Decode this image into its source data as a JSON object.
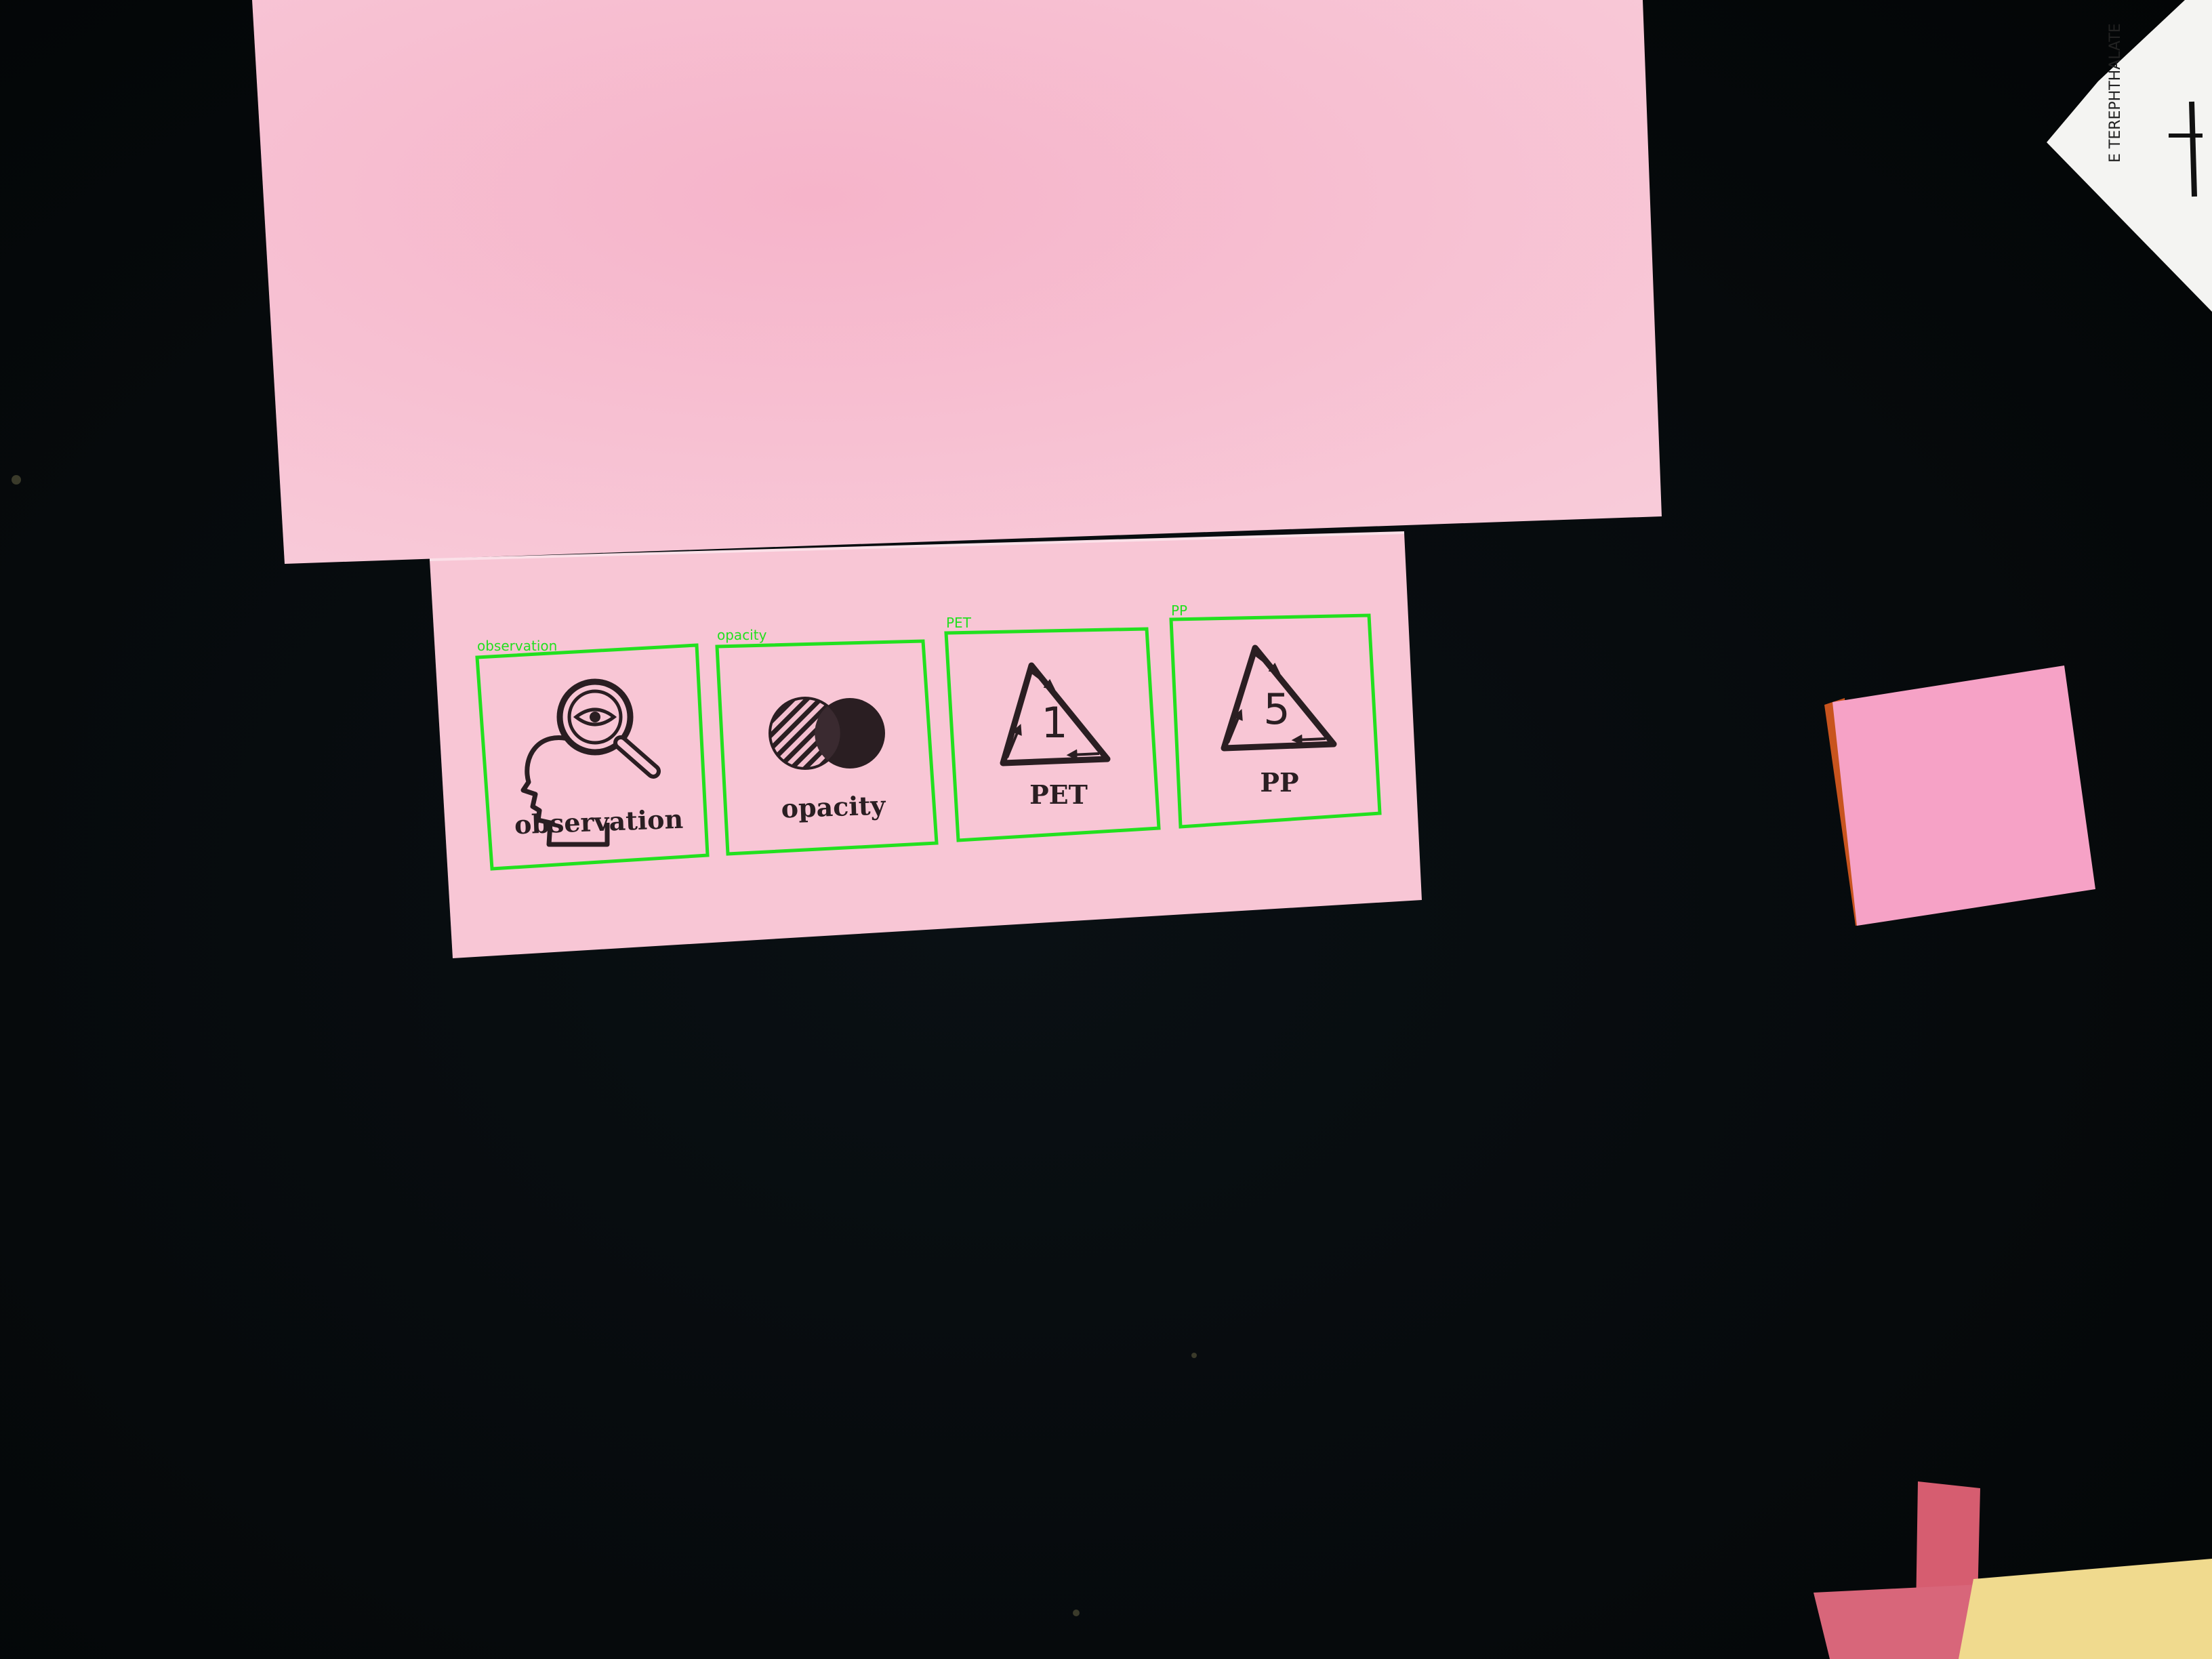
{
  "scene": {
    "background_color": "#05090b",
    "paper_color": "#f7c3d3",
    "sticky_note_color": "#f5a3c4",
    "detection_color": "#22e01f"
  },
  "icons": {
    "observation": {
      "caption": "observation",
      "detection_label": "observation",
      "icon": "head-magnifier-eye-icon"
    },
    "opacity": {
      "caption": "opacity",
      "detection_label": "opacity",
      "icon": "overlapping-circles-icon"
    },
    "pet": {
      "caption": "PET",
      "detection_label": "PET",
      "code": "1",
      "icon": "recycle-triangle-icon"
    },
    "pp": {
      "caption": "PP",
      "detection_label": "PP",
      "code": "5",
      "icon": "recycle-triangle-icon"
    }
  },
  "corner_document": {
    "text": "E TEREPHTHALATE"
  }
}
